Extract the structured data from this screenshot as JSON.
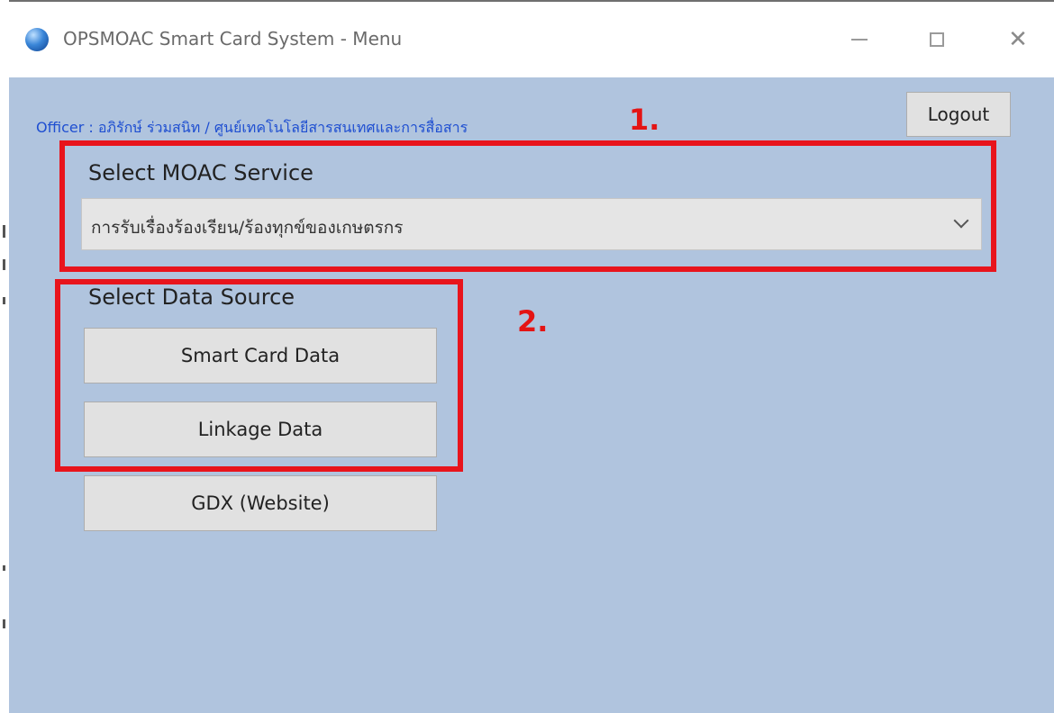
{
  "window": {
    "title": "OPSMOAC Smart Card System - Menu",
    "icon": "globe-icon",
    "controls": [
      "minimize-icon",
      "maximize-icon",
      "close-icon"
    ]
  },
  "header": {
    "officer_text": "Officer : อภิรักษ์ ร่วมสนิท / ศูนย์เทคโนโลยีสารสนเทศและการสื่อสาร",
    "logout_label": "Logout"
  },
  "service": {
    "heading": "Select MOAC Service",
    "selected": "การรับเรื่องร้องเรียน/ร้องทุกข์ของเกษตรกร"
  },
  "data_source": {
    "heading": "Select Data Source",
    "smart_card_label": "Smart Card Data",
    "linkage_label": "Linkage Data"
  },
  "gdx_label": "GDX (Website)",
  "annotations": {
    "step1": "1.",
    "step2": "2.",
    "color": "#e8141c"
  },
  "colors": {
    "background": "#b0c4de",
    "officer_text": "#1f4fd1",
    "button": "#e1e1e1"
  }
}
